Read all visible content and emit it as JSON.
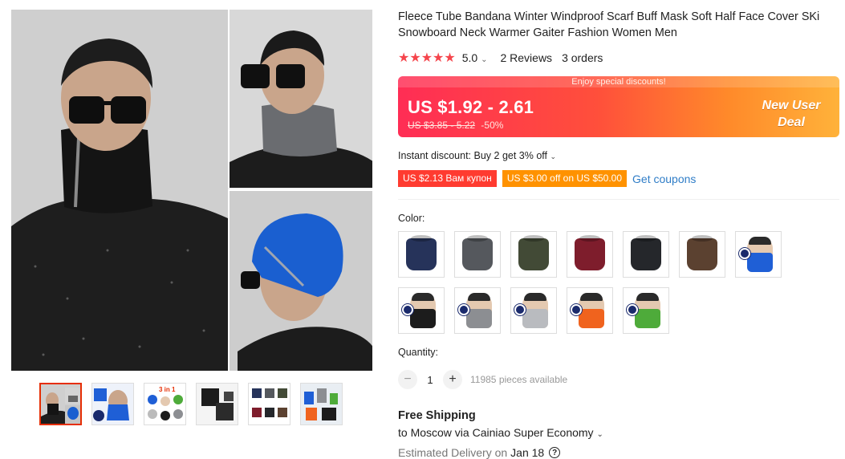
{
  "product": {
    "title": "Fleece Tube Bandana Winter Windproof Scarf Buff Mask Soft Half Face Cover SKi Snowboard Neck Warmer Gaiter Fashion Women Men",
    "rating": "5.0",
    "reviews": "2 Reviews",
    "orders": "3 orders"
  },
  "price_banner": {
    "enjoy": "Enjoy special discounts!",
    "price": "US $1.92 - 2.61",
    "old_price": "US $3.85 - 5.22",
    "discount": "-50%",
    "badge_line1": "New User",
    "badge_line2": "Deal"
  },
  "discounts": {
    "instant_label": "Instant discount: Buy 2 get 3% off",
    "coupon1": "US $2.13 Вам купон",
    "coupon2": "US $3.00 off on US $50.00",
    "get_coupons": "Get coupons"
  },
  "color": {
    "label": "Color:",
    "options": [
      {
        "name": "navy",
        "color": "#26335a",
        "type": "plain"
      },
      {
        "name": "gray",
        "color": "#55585d",
        "type": "plain"
      },
      {
        "name": "army-green",
        "color": "#424a36",
        "type": "plain"
      },
      {
        "name": "wine-red",
        "color": "#7e1d2c",
        "type": "plain"
      },
      {
        "name": "black",
        "color": "#25272b",
        "type": "plain"
      },
      {
        "name": "brown",
        "color": "#5b4130",
        "type": "plain"
      },
      {
        "name": "blue-model",
        "color": "#1f5fd6",
        "type": "model"
      },
      {
        "name": "black-model",
        "color": "#1c1c1c",
        "type": "model"
      },
      {
        "name": "gray-model",
        "color": "#8c8e92",
        "type": "model"
      },
      {
        "name": "light-gray-model",
        "color": "#b9bbbf",
        "type": "model"
      },
      {
        "name": "orange-model",
        "color": "#f0631e",
        "type": "model"
      },
      {
        "name": "green-model",
        "color": "#4eab3a",
        "type": "model"
      }
    ]
  },
  "quantity": {
    "label": "Quantity:",
    "value": "1",
    "minus": "−",
    "plus": "+",
    "available": "11985 pieces available"
  },
  "shipping": {
    "title": "Free Shipping",
    "to": "to Moscow via Cainiao Super Economy",
    "delivery_label": "Estimated Delivery on",
    "delivery_date": "Jan 18"
  },
  "icons": {
    "stars": "★★★★★",
    "chevron": "⌄",
    "help": "?"
  }
}
